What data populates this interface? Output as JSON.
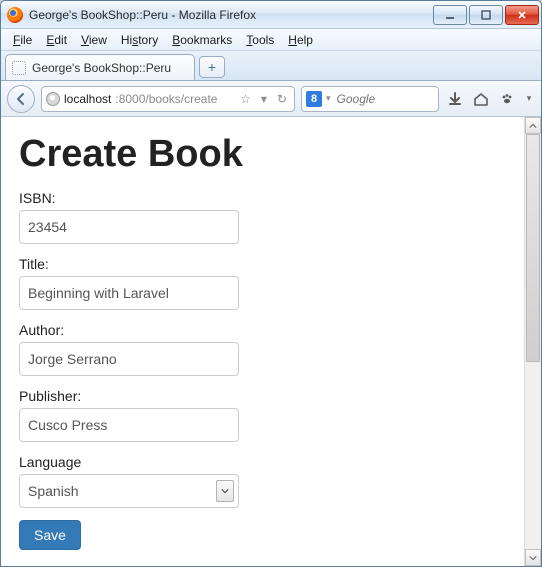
{
  "window": {
    "title": "George's BookShop::Peru - Mozilla Firefox"
  },
  "menubar": {
    "file": {
      "text": "File",
      "ul": "F"
    },
    "edit": {
      "text": "Edit",
      "ul": "E"
    },
    "view": {
      "text": "View",
      "ul": "V"
    },
    "history": {
      "text": "History",
      "ul": "s"
    },
    "bookmarks": {
      "text": "Bookmarks",
      "ul": "B"
    },
    "tools": {
      "text": "Tools",
      "ul": "T"
    },
    "help": {
      "text": "Help",
      "ul": "H"
    }
  },
  "tab": {
    "label": "George's BookShop::Peru"
  },
  "url": {
    "host": "localhost",
    "port_path": ":8000/books/create"
  },
  "search": {
    "engine_badge": "8",
    "placeholder": "Google"
  },
  "page": {
    "heading": "Create Book",
    "fields": {
      "isbn": {
        "label": "ISBN:",
        "value": "23454"
      },
      "title": {
        "label": "Title:",
        "value": "Beginning with Laravel"
      },
      "author": {
        "label": "Author:",
        "value": "Jorge Serrano"
      },
      "publisher": {
        "label": "Publisher:",
        "value": "Cusco Press"
      },
      "language": {
        "label": "Language",
        "value": "Spanish"
      }
    },
    "save_label": "Save"
  }
}
